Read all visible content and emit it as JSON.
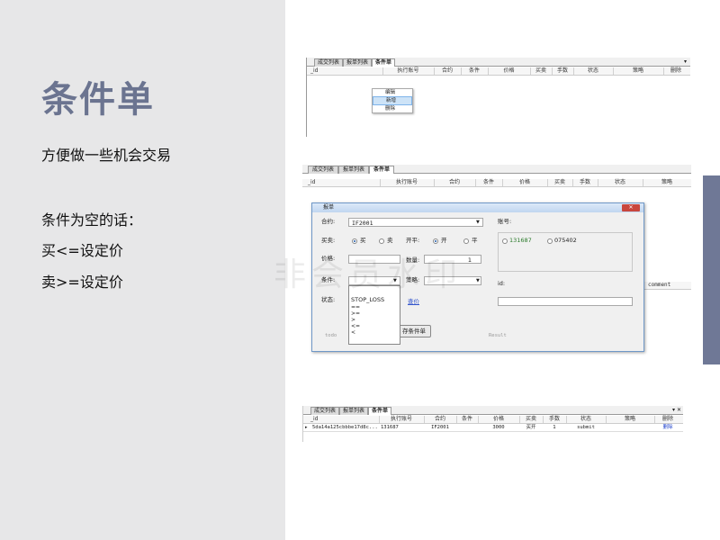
{
  "slide": {
    "title": "条件单",
    "line1": "方便做一些机会交易",
    "line2": "条件为空的话：",
    "line3": "买<=设定价",
    "line4": "卖>=设定价",
    "watermark": "非会员水印"
  },
  "tabs": [
    "成交列表",
    "报单列表",
    "条件单"
  ],
  "columns": {
    "id": "_id",
    "exec": "执行账号",
    "contract": "合约",
    "cond": "条件",
    "price": "价格",
    "bs": "买卖",
    "qty": "手数",
    "status": "状态",
    "strategy": "策略",
    "delete": "删除",
    "comment": "comment"
  },
  "context_menu": [
    "编辑",
    "新增",
    "删除"
  ],
  "dialog": {
    "title": "报单",
    "contract_label": "合约:",
    "contract_value": "IF2001",
    "account_label": "账号:",
    "accounts": [
      "131687",
      "075402"
    ],
    "bs_label": "买卖:",
    "buy": "买",
    "sell": "卖",
    "oc_label": "开平:",
    "open": "开",
    "close": "平",
    "price_label": "价格:",
    "qty_label": "数量:",
    "qty_value": "1",
    "cond_label": "条件:",
    "strategy_label": "策略:",
    "status_label": "状态:",
    "id_label": "id:",
    "cond_options": [
      "STOP_LOSS",
      "==",
      ">=",
      ">",
      "<=",
      "<"
    ],
    "link_text": "查价",
    "save_button": "存条件单",
    "todo_text": "todo",
    "result_text": "Result"
  },
  "row": {
    "id": "5da14a125cbbbe17d8c...",
    "exec": "131687",
    "contract": "IF2001",
    "cond": "",
    "price": "3000",
    "bs": "买开",
    "qty": "1",
    "status": "submit",
    "strategy": "",
    "delete": "删除"
  },
  "panel_controls": "▾ ✕",
  "colors": {
    "title": "#6b7490",
    "accent_bar": "#6f7896",
    "left_panel": "#e7e7e8"
  }
}
